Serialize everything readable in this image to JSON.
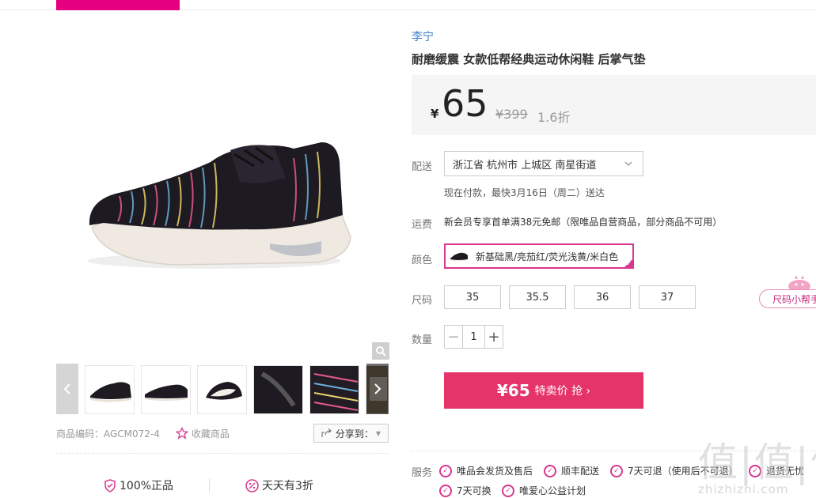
{
  "product": {
    "brand": "李宁",
    "title": "耐磨缓震 女款低帮经典运动休闲鞋 后掌气垫",
    "sku_label": "商品编码：AGCM072-4",
    "favorite_label": "收藏商品",
    "share_label": "分享到："
  },
  "price": {
    "currency": "¥",
    "current": "65",
    "original": "¥399",
    "discount": "1.6折"
  },
  "delivery": {
    "label": "配送",
    "address": "浙江省 杭州市 上城区 南星街道",
    "note": "现在付款，最快3月16日（周二）送达"
  },
  "shipping": {
    "label": "运费",
    "text": "新会员专享首单满38元免邮（限唯品自营商品，部分商品不可用）"
  },
  "color": {
    "label": "颜色",
    "selected": "新基础黑/亮茄红/荧光浅黄/米白色"
  },
  "size": {
    "label": "尺码",
    "options": [
      "35",
      "35.5",
      "36",
      "37"
    ],
    "helper": "尺码小帮手"
  },
  "quantity": {
    "label": "数量",
    "value": "1",
    "minus": "−",
    "plus": "+"
  },
  "buy_button": {
    "price": "¥65",
    "label": "特卖价 抢 ›"
  },
  "services": {
    "label": "服务",
    "items": [
      "唯品会发货及售后",
      "顺丰配送",
      "7天可退（使用后不可退）",
      "退货无忧",
      "7天可换",
      "唯爱心公益计划"
    ]
  },
  "guarantees": [
    "100%正品",
    "天天有3折"
  ],
  "watermark": {
    "cn": "值|值|值",
    "en": "zhizhizhi.com"
  },
  "colors": {
    "accent": "#e4007f",
    "buy": "#e4346a",
    "brand_link": "#3d7ec7"
  }
}
